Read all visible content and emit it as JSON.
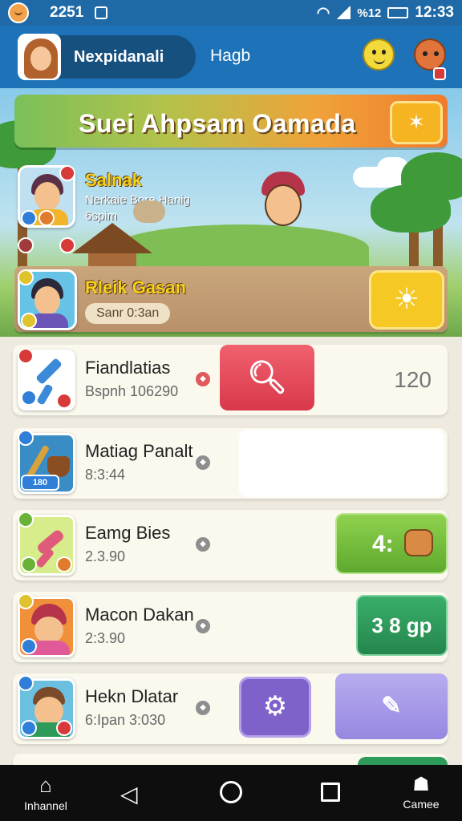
{
  "status_bar": {
    "left_text": "2251",
    "time": "12:33",
    "indicator_text": "%12"
  },
  "header": {
    "profile_name": "Nexpidanali",
    "link_text": "Hagb"
  },
  "banner": {
    "title": "Suei Ahpsam Oamada",
    "featured_name": "Salnak",
    "featured_sub": "Nerkaie Bore Hanig",
    "featured_sub2": "6spim"
  },
  "feature_row": {
    "title": "Rleik Gasan",
    "timer": "Sanr 0:3an"
  },
  "list": [
    {
      "title": "Fiandlatias",
      "subtitle": "Bspnh 106290",
      "value": "120",
      "icon": "blue-tool-icon"
    },
    {
      "title": "Matiag Panalt",
      "subtitle": "8:3:44",
      "badge_text": "180",
      "icon": "axe-pot-icon"
    },
    {
      "title": "Eamg Bies",
      "subtitle": "2.3.90",
      "action_text": "4:",
      "icon": "pink-brush-icon"
    },
    {
      "title": "Macon Dakan",
      "subtitle": "2:3.90",
      "action_text": "3 8 gp",
      "icon": "hat-girl-icon"
    },
    {
      "title": "Hekn Dlatar",
      "subtitle": "6:Ipan 3:030",
      "icon": "boy-avatar-icon"
    }
  ],
  "nav": {
    "home_label": "Inhannel",
    "games_label": "Camee"
  },
  "colors": {
    "header": "#1e73b8",
    "accent_orange": "#ef7b2c",
    "accent_yellow": "#f5c823",
    "red_button": "#e2485a",
    "green_button": "#6ab235",
    "teal_button": "#2e9a5a",
    "purple": "#7e61c9"
  }
}
